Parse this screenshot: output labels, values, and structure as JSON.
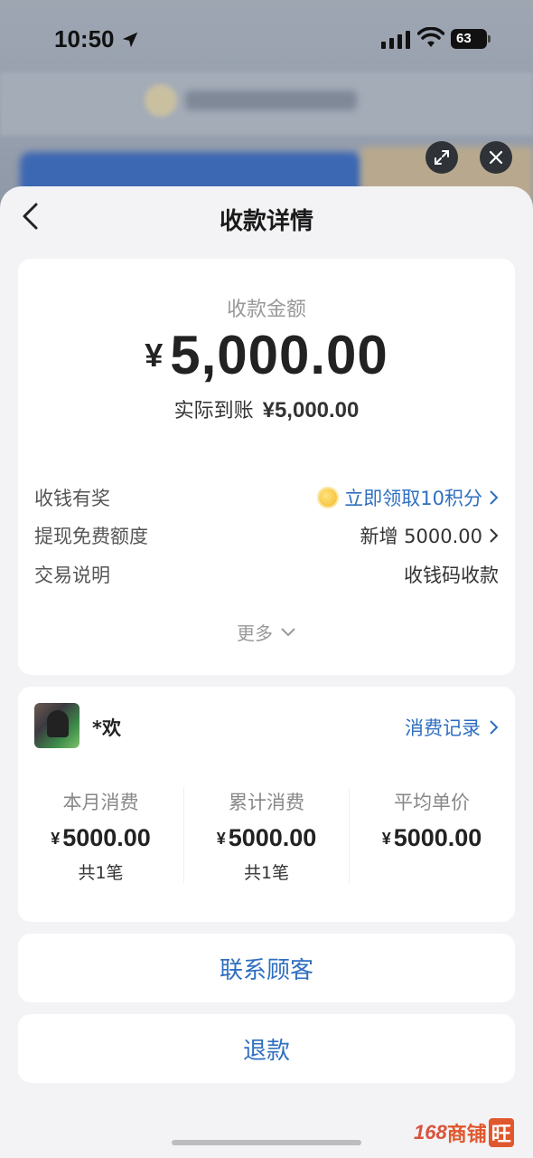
{
  "status_bar": {
    "time": "10:50",
    "battery": "63"
  },
  "sheet": {
    "title": "收款详情"
  },
  "amount": {
    "label": "收款金额",
    "currency": "¥",
    "value": "5,000.00",
    "received_label": "实际到账",
    "received_value": "¥5,000.00"
  },
  "info_rows": [
    {
      "label": "收钱有奖",
      "value": "立即领取10积分",
      "icon": "coin-icon"
    },
    {
      "label": "提现免费额度",
      "value": "新增 5000.00"
    },
    {
      "label": "交易说明",
      "value": "收钱码收款"
    }
  ],
  "more_label": "更多",
  "customer": {
    "name": "*欢",
    "records_link": "消费记录",
    "stats": [
      {
        "label": "本月消费",
        "currency": "¥",
        "value": "5000.00",
        "count": "共1笔"
      },
      {
        "label": "累计消费",
        "currency": "¥",
        "value": "5000.00",
        "count": "共1笔"
      },
      {
        "label": "平均单价",
        "currency": "¥",
        "value": "5000.00",
        "count": ""
      }
    ]
  },
  "actions": {
    "contact": "联系顾客",
    "refund": "退款"
  },
  "watermark": {
    "number": "168",
    "text": "商铺",
    "badge": "旺"
  },
  "colors": {
    "link_blue": "#2f6fc0",
    "sheet_bg": "#f3f3f5",
    "card_bg": "#ffffff",
    "watermark_orange": "#e0572d"
  }
}
